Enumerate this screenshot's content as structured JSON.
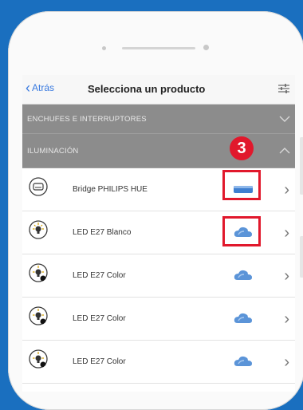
{
  "nav": {
    "back_label": "Atrás",
    "title": "Selecciona un producto"
  },
  "sections": [
    {
      "label": "ENCHUFES E INTERRUPTORES"
    },
    {
      "label": "ILUMINACIÓN"
    }
  ],
  "rows": [
    {
      "label": "Bridge PHILIPS HUE",
      "icon": "bridge-icon",
      "status_icon": "bridge-device-icon"
    },
    {
      "label": "LED E27 Blanco",
      "icon": "bulb-icon",
      "status_icon": "cloud-icon"
    },
    {
      "label": "LED E27 Color",
      "icon": "bulb-color-icon",
      "status_icon": "cloud-icon"
    },
    {
      "label": "LED E27 Color",
      "icon": "bulb-color-icon",
      "status_icon": "cloud-icon"
    },
    {
      "label": "LED E27 Color",
      "icon": "bulb-color-icon",
      "status_icon": "cloud-icon"
    }
  ],
  "annotation": {
    "step": "3"
  },
  "colors": {
    "background": "#1a6fbf",
    "accent": "#3b7be0",
    "highlight": "#e1182c",
    "section": "#8c8c8c"
  }
}
